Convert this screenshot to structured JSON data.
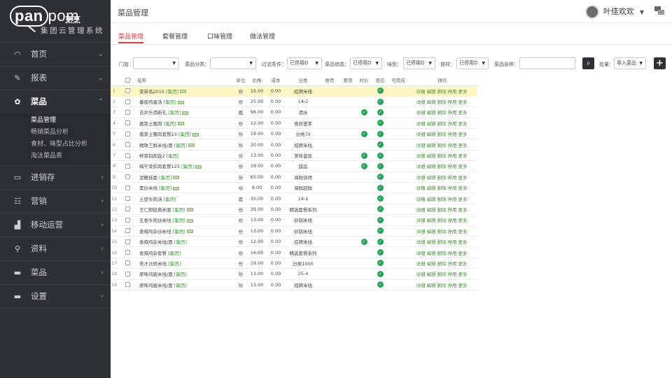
{
  "brand": {
    "logo_main": "panpom",
    "logo_pan": "pan",
    "logo_pom": "pom",
    "logo_cn": "烹烹",
    "subtitle": "集团云管理系统"
  },
  "sidebar": {
    "items": [
      {
        "label": "首页",
        "icon": "dashboard-icon"
      },
      {
        "label": "报表",
        "icon": "pencil-icon"
      },
      {
        "label": "菜品",
        "icon": "gear-icon",
        "active": true
      },
      {
        "label": "进销存",
        "icon": "monitor-icon"
      },
      {
        "label": "营销",
        "icon": "grid-icon"
      },
      {
        "label": "移动运营",
        "icon": "bar-chart-icon"
      },
      {
        "label": "资料",
        "icon": "location-icon"
      },
      {
        "label": "菜品",
        "icon": "folder-icon"
      },
      {
        "label": "设置",
        "icon": "folder-icon"
      }
    ],
    "submenu": [
      "菜品管理",
      "畅销菜品分析",
      "食材、味型占比分析",
      "淘汰菜品表"
    ]
  },
  "header": {
    "title": "菜品管理",
    "user_name": "叶佳欢欢"
  },
  "tabs": [
    "菜品管理",
    "套餐管理",
    "口味管理",
    "做法管理"
  ],
  "filter": {
    "store_label": "门店：",
    "category_label": "菜品分类：",
    "condition_label": "过滤条件：",
    "condition_value": "已停用D",
    "status_label": "菜品状态：",
    "status_value": "已停用D",
    "flavor_label": "味型：",
    "flavor_value": "已停用D",
    "ingredient_label": "食材：",
    "ingredient_value": "已停用D",
    "name_label": "菜品名称：",
    "batch_label": "批量：",
    "batch_value": "导入菜品"
  },
  "table": {
    "headers": [
      "名称",
      "单位",
      "价格",
      "成本",
      "分类",
      "推荐",
      "要菜",
      "时价",
      "状态",
      "可煲成",
      "操作"
    ],
    "group_tag": "[集团]",
    "ops": [
      "详细",
      "编辑",
      "删除",
      "停用",
      "更多"
    ],
    "rows": [
      {
        "n": "1",
        "name": "菜单名2015",
        "unit": "份",
        "price": "15.00",
        "cost": "0.00",
        "cat": "招牌米线",
        "img": true,
        "hl": true,
        "tp": false
      },
      {
        "n": "2",
        "name": "番茄鸡蛋汤",
        "unit": "份",
        "price": "25.00",
        "cost": "0.00",
        "cat": "14-2",
        "img": true,
        "tp": false
      },
      {
        "n": "3",
        "name": "吉井乐酒新礼",
        "unit": "瓶",
        "price": "98.00",
        "cost": "0.00",
        "cat": "酒水",
        "img": true,
        "tp": true
      },
      {
        "n": "4",
        "name": "酱菜土豬肉",
        "unit": "份",
        "price": "12.00",
        "cost": "0.00",
        "cat": "食尚荟萃",
        "img": true,
        "tp": false
      },
      {
        "n": "5",
        "name": "酱菜土豬肉套餐23",
        "unit": "份",
        "price": "19.00",
        "cost": "0.00",
        "cat": "分类70",
        "img": true,
        "tp": true
      },
      {
        "n": "6",
        "name": "精致三鲜米线/面",
        "unit": "份",
        "price": "20.00",
        "cost": "0.00",
        "cat": "招牌米线",
        "img": true,
        "tp": false
      },
      {
        "n": "7",
        "name": "榨菜扣肉饭2",
        "unit": "份",
        "price": "13.00",
        "cost": "0.00",
        "cat": "美味盖饭",
        "img": false,
        "tp": true
      },
      {
        "n": "8",
        "name": "梅干菜扣肉套餐123",
        "unit": "份",
        "price": "19.00",
        "cost": "0.00",
        "cat": "甜品",
        "img": true,
        "tp": true
      },
      {
        "n": "9",
        "name": "泥鳅挂面",
        "unit": "份",
        "price": "65.00",
        "cost": "0.00",
        "cat": "海鲜烧烤",
        "img": true,
        "tp": false
      },
      {
        "n": "10",
        "name": "素炒米线",
        "unit": "份",
        "price": "9.00",
        "cost": "0.00",
        "cat": "海鲜超鲜",
        "img": true,
        "tp": false
      },
      {
        "n": "11",
        "name": "土豆牛肉汤",
        "unit": "套",
        "price": "35.00",
        "cost": "0.00",
        "cat": "14-1",
        "img": false,
        "tp": false
      },
      {
        "n": "12",
        "name": "王仁和经典米面",
        "unit": "份",
        "price": "39.00",
        "cost": "0.00",
        "cat": "精选套餐系列",
        "img": true,
        "tp": false
      },
      {
        "n": "13",
        "name": "五香牛肉炒米线",
        "unit": "份",
        "price": "13.00",
        "cost": "0.00",
        "cat": "砂锅米线",
        "img": true,
        "tp": false
      },
      {
        "n": "14",
        "name": "香辣鸡杂炒米线",
        "unit": "份",
        "price": "13.00",
        "cost": "0.00",
        "cat": "砂锅米线",
        "img": true,
        "tp": false
      },
      {
        "n": "15",
        "name": "香辣鸡杂米线/面",
        "unit": "份",
        "price": "12.00",
        "cost": "0.00",
        "cat": "招牌米线",
        "img": false,
        "tp": true
      },
      {
        "n": "16",
        "name": "香辣鸡杂套餐",
        "unit": "份",
        "price": "16.00",
        "cost": "0.00",
        "cat": "精选套餐系列",
        "img": false,
        "tp": false
      },
      {
        "n": "17",
        "name": "秀才过桥米线",
        "unit": "份",
        "price": "19.00",
        "cost": "0.00",
        "cat": "分类1000",
        "img": false,
        "tp": false
      },
      {
        "n": "18",
        "name": "原味鸡腿米线/面",
        "unit": "份",
        "price": "13.00",
        "cost": "0.00",
        "cat": "25-4",
        "img": false,
        "tp": false
      },
      {
        "n": "19",
        "name": "原味鸡腿米线/面",
        "unit": "份",
        "price": "13.00",
        "cost": "0.00",
        "cat": "招牌米线",
        "img": false,
        "tp": false
      }
    ]
  }
}
